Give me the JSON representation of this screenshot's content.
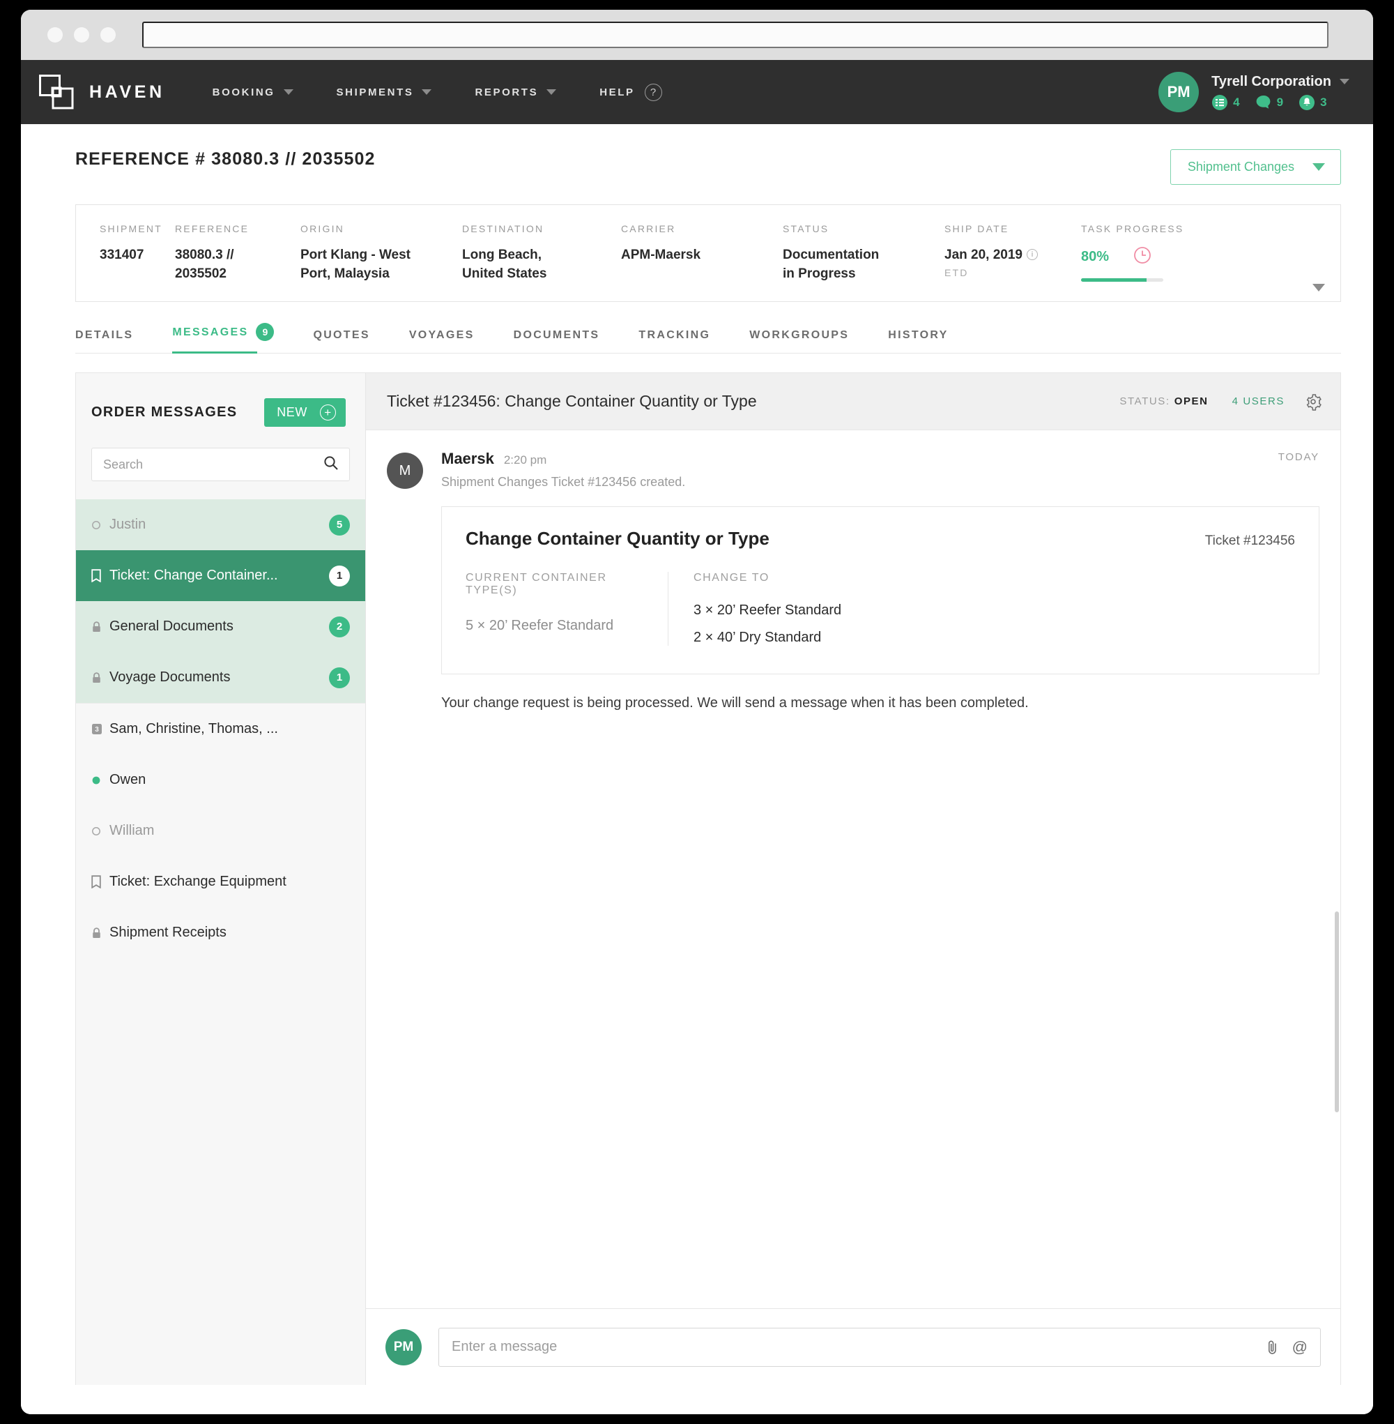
{
  "browser": {
    "url_value": ""
  },
  "topnav": {
    "brand": "HAVEN",
    "items": [
      {
        "label": "BOOKING",
        "caret": true
      },
      {
        "label": "SHIPMENTS",
        "caret": true
      },
      {
        "label": "REPORTS",
        "caret": true
      },
      {
        "label": "HELP",
        "caret": false,
        "help_icon": "question-mark-icon"
      }
    ],
    "user": {
      "avatar_initials": "PM",
      "org_name": "Tyrell Corporation",
      "badges": [
        {
          "icon": "tasks-list-icon",
          "count": "4"
        },
        {
          "icon": "chat-bubble-icon",
          "count": "9"
        },
        {
          "icon": "bell-icon",
          "count": "3"
        }
      ]
    }
  },
  "page": {
    "reference_title": "REFERENCE # 38080.3 // 2035502",
    "shipment_changes_button": "Shipment Changes"
  },
  "summary": {
    "columns": [
      {
        "label": "SHIPMENT",
        "value": "331407"
      },
      {
        "label": "REFERENCE",
        "value": "38080.3 // 2035502"
      },
      {
        "label": "ORIGIN",
        "value": "Port Klang - West Port, Malaysia"
      },
      {
        "label": "DESTINATION",
        "value": "Long Beach, United States"
      },
      {
        "label": "CARRIER",
        "value": "APM-Maersk"
      },
      {
        "label": "STATUS",
        "value": "Documentation in Progress"
      }
    ],
    "ship_date": {
      "label": "SHIP DATE",
      "value": "Jan 20, 2019",
      "sub": "ETD"
    },
    "task_progress": {
      "label": "TASK PROGRESS",
      "percent_text": "80%",
      "percent": 80,
      "clock_icon": "clock-icon",
      "accent": "#3cbb87",
      "clock_color": "#f08ca4"
    }
  },
  "tabs": [
    {
      "label": "DETAILS",
      "active": false,
      "count": null
    },
    {
      "label": "MESSAGES",
      "active": true,
      "count": "9"
    },
    {
      "label": "QUOTES",
      "active": false,
      "count": null
    },
    {
      "label": "VOYAGES",
      "active": false,
      "count": null
    },
    {
      "label": "DOCUMENTS",
      "active": false,
      "count": null
    },
    {
      "label": "TRACKING",
      "active": false,
      "count": null
    },
    {
      "label": "WORKGROUPS",
      "active": false,
      "count": null
    },
    {
      "label": "HISTORY",
      "active": false,
      "count": null
    }
  ],
  "sidebar": {
    "title": "ORDER MESSAGES",
    "new_button": "NEW",
    "search_placeholder": "Search",
    "search_value": "",
    "items": [
      {
        "label": "Justin",
        "icon": "circle-outline-icon",
        "count": "5",
        "state": "unread-muted"
      },
      {
        "label": "Ticket: Change Container...",
        "icon": "ticket-icon",
        "count": "1",
        "state": "selected"
      },
      {
        "label": "General Documents",
        "icon": "lock-icon",
        "count": "2",
        "state": "unread"
      },
      {
        "label": "Voyage Documents",
        "icon": "lock-icon",
        "count": "1",
        "state": "unread"
      },
      {
        "label": "Sam, Christine, Thomas, ...",
        "icon": "group-3-icon",
        "count": null,
        "state": "read"
      },
      {
        "label": "Owen",
        "icon": "circle-filled-icon",
        "count": null,
        "state": "read"
      },
      {
        "label": "William",
        "icon": "circle-outline-icon",
        "count": null,
        "state": "read-muted"
      },
      {
        "label": "Ticket: Exchange Equipment",
        "icon": "ticket-icon",
        "count": null,
        "state": "read"
      },
      {
        "label": "Shipment Receipts",
        "icon": "lock-icon",
        "count": null,
        "state": "read"
      }
    ]
  },
  "conversation": {
    "header": {
      "title": "Ticket #123456: Change Container Quantity or Type",
      "status_label": "STATUS:",
      "status_value": "OPEN",
      "users": "4 USERS",
      "gear_icon": "gear-icon"
    },
    "today_label": "TODAY",
    "message": {
      "avatar_initials": "M",
      "author": "Maersk",
      "time": "2:20 pm",
      "system_text": "Shipment Changes Ticket #123456 created.",
      "follow_up": "Your change request is being processed. We will send a message when it has been completed."
    },
    "ticket_card": {
      "title": "Change Container Quantity or Type",
      "ticket_id": "Ticket #123456",
      "current_label": "CURRENT CONTAINER TYPE(S)",
      "current_values": [
        "5 × 20’ Reefer Standard"
      ],
      "change_label": "CHANGE TO",
      "change_values": [
        "3 × 20’ Reefer Standard",
        "2 × 40’ Dry Standard"
      ]
    },
    "composer": {
      "avatar_initials": "PM",
      "placeholder": "Enter a message",
      "value": "",
      "attach_icon": "paperclip-icon",
      "mention_icon": "at-sign-icon"
    }
  }
}
